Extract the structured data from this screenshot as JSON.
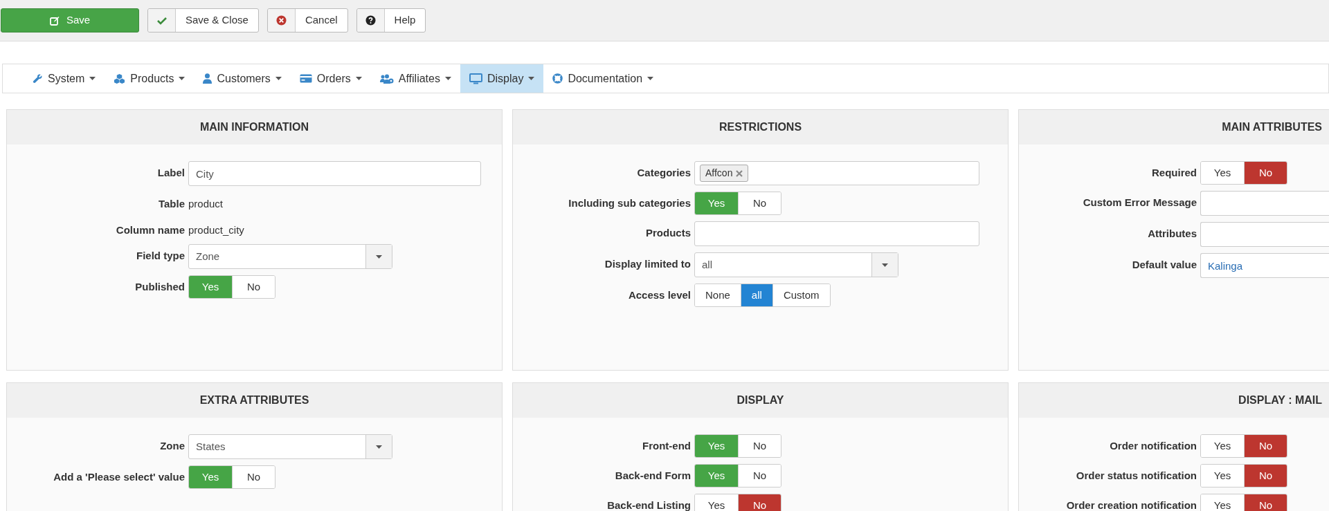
{
  "toolbar": [
    {
      "kind": "save",
      "label": "Save"
    },
    {
      "kind": "check",
      "label": "Save & Close"
    },
    {
      "kind": "cancel",
      "label": "Cancel"
    },
    {
      "kind": "help",
      "label": "Help"
    }
  ],
  "menu": [
    {
      "kind": "wrench",
      "label": "System",
      "selected": false
    },
    {
      "kind": "cubes",
      "label": "Products",
      "selected": false
    },
    {
      "kind": "user",
      "label": "Customers",
      "selected": false
    },
    {
      "kind": "card",
      "label": "Orders",
      "selected": false
    },
    {
      "kind": "users",
      "label": "Affiliates",
      "selected": false
    },
    {
      "kind": "monitor",
      "label": "Display",
      "selected": true
    },
    {
      "kind": "lifebuoy",
      "label": "Documentation",
      "selected": false
    }
  ],
  "panels": [
    {
      "title": "MAIN INFORMATION",
      "fields": [
        {
          "kind": "text",
          "label": "Label",
          "value": "City"
        },
        {
          "kind": "static",
          "label": "Table",
          "value": "product"
        },
        {
          "kind": "static",
          "label": "Column name",
          "value": "product_city"
        },
        {
          "kind": "select",
          "label": "Field type",
          "value": "Zone"
        },
        {
          "kind": "yesno",
          "label": "Published",
          "options": [
            {
              "label": "Yes",
              "selected": true
            },
            {
              "label": "No",
              "selected": false
            }
          ]
        }
      ]
    },
    {
      "title": "RESTRICTIONS",
      "fields": [
        {
          "kind": "tags",
          "label": "Categories",
          "tags": [
            "Affcon"
          ]
        },
        {
          "kind": "yesno",
          "label": "Including sub categories",
          "options": [
            {
              "label": "Yes",
              "selected": true
            },
            {
              "label": "No",
              "selected": false
            }
          ]
        },
        {
          "kind": "text",
          "label": "Products"
        },
        {
          "kind": "select",
          "label": "Display limited to",
          "value": "all"
        },
        {
          "kind": "choice",
          "label": "Access level",
          "options": [
            {
              "label": "None",
              "selected": false
            },
            {
              "label": "all",
              "selected": true
            },
            {
              "label": "Custom",
              "selected": false
            }
          ]
        }
      ]
    },
    {
      "title": "MAIN ATTRIBUTES",
      "fields": [
        {
          "kind": "yesno",
          "label": "Required",
          "options": [
            {
              "label": "Yes",
              "selected": false
            },
            {
              "label": "No",
              "selected": true
            }
          ]
        },
        {
          "kind": "text",
          "label": "Custom Error Message"
        },
        {
          "kind": "text",
          "label": "Attributes"
        },
        {
          "kind": "link",
          "label": "Default value",
          "value": "Kalinga"
        }
      ]
    },
    {
      "title": "EXTRA ATTRIBUTES",
      "fields": [
        {
          "kind": "select",
          "label": "Zone",
          "value": "States"
        },
        {
          "kind": "yesno",
          "label": "Add a 'Please select' value",
          "options": [
            {
              "label": "Yes",
              "selected": true
            },
            {
              "label": "No",
              "selected": false
            }
          ]
        }
      ]
    },
    {
      "title": "DISPLAY",
      "fields": [
        {
          "kind": "yesno",
          "label": "Front-end",
          "options": [
            {
              "label": "Yes",
              "selected": true
            },
            {
              "label": "No",
              "selected": false
            }
          ]
        },
        {
          "kind": "yesno",
          "label": "Back-end Form",
          "options": [
            {
              "label": "Yes",
              "selected": true
            },
            {
              "label": "No",
              "selected": false
            }
          ]
        },
        {
          "kind": "yesno",
          "label": "Back-end Listing",
          "options": [
            {
              "label": "Yes",
              "selected": false
            },
            {
              "label": "No",
              "selected": true
            }
          ]
        }
      ]
    },
    {
      "title": "DISPLAY : MAIL",
      "fields": [
        {
          "kind": "yesno",
          "label": "Order notification",
          "options": [
            {
              "label": "Yes",
              "selected": false
            },
            {
              "label": "No",
              "selected": true
            }
          ]
        },
        {
          "kind": "yesno",
          "label": "Order status notification",
          "options": [
            {
              "label": "Yes",
              "selected": false
            },
            {
              "label": "No",
              "selected": true
            }
          ]
        },
        {
          "kind": "yesno",
          "label": "Order creation notification",
          "options": [
            {
              "label": "Yes",
              "selected": false
            },
            {
              "label": "No",
              "selected": true
            }
          ]
        }
      ]
    }
  ]
}
